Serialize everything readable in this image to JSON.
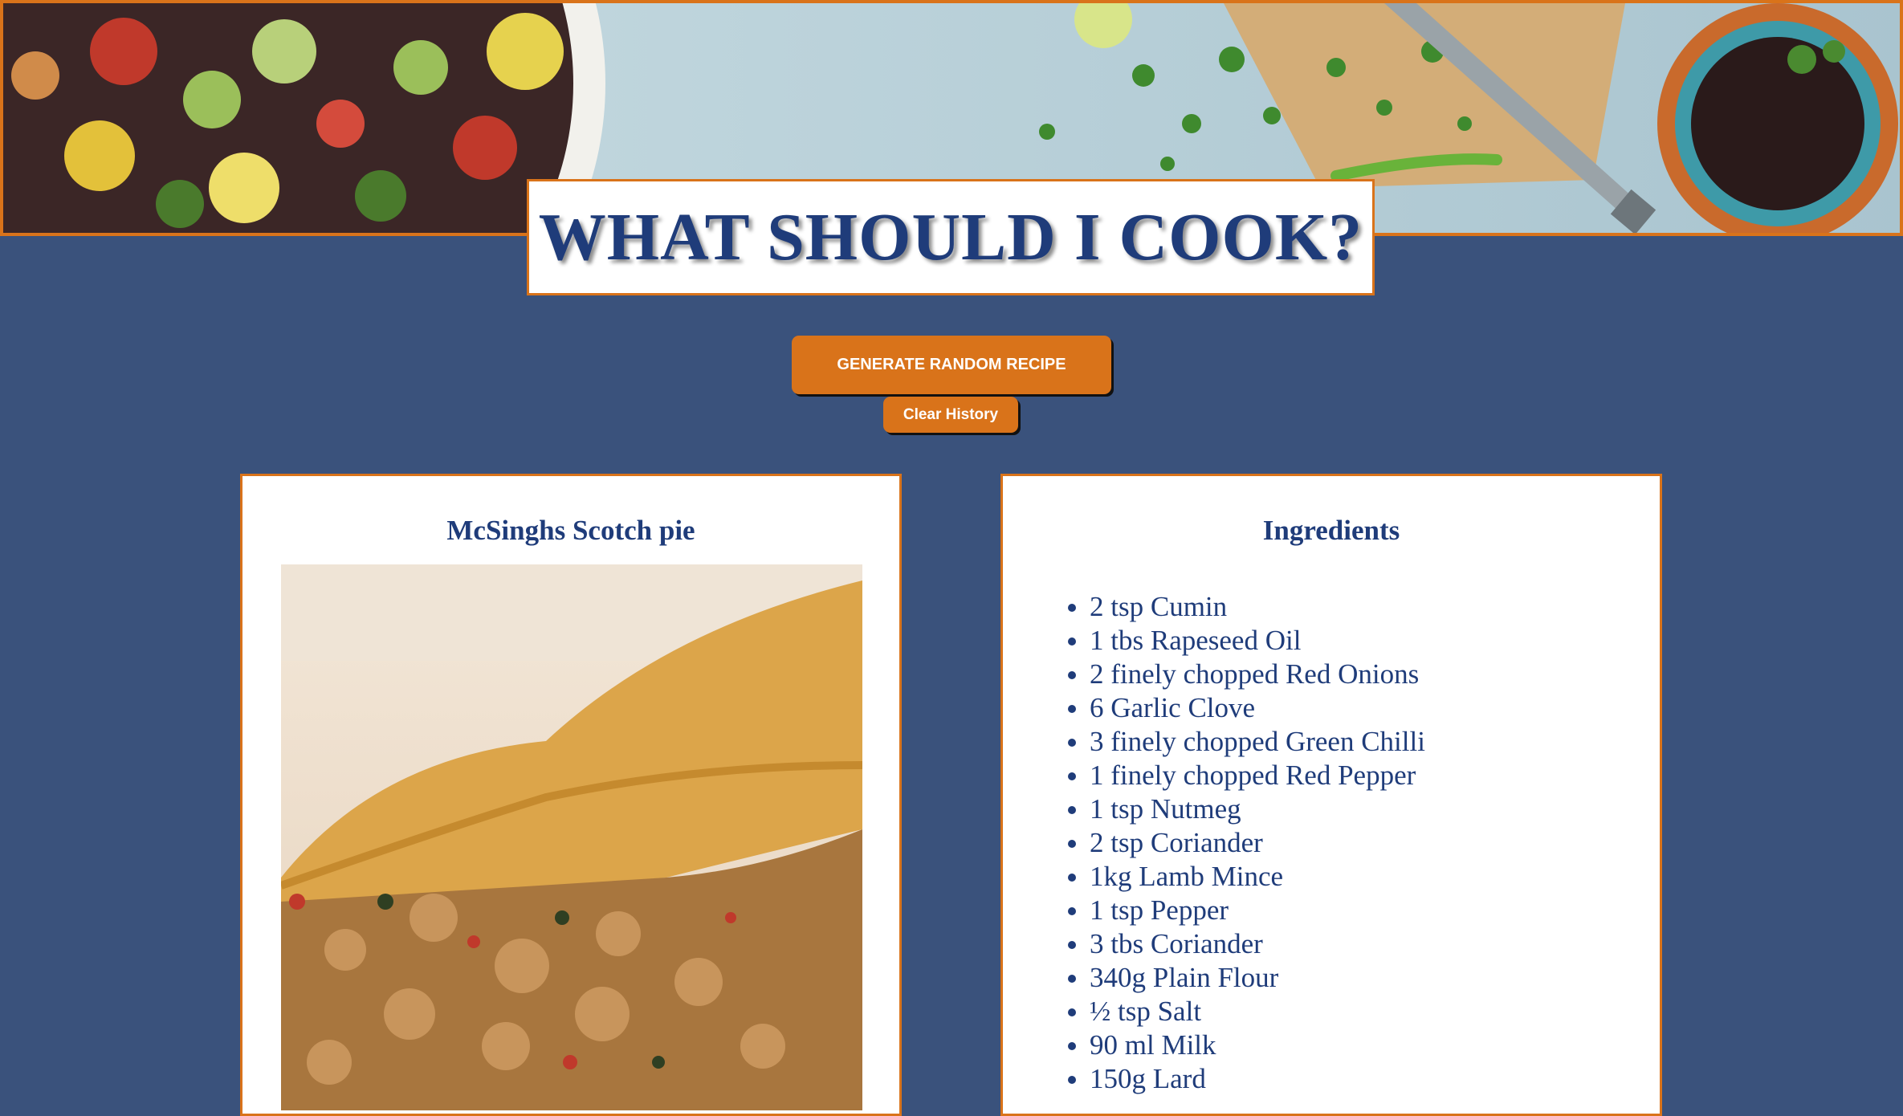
{
  "header": {
    "title": "WHAT SHOULD I COOK?",
    "hero_image": "food-ingredients-banner"
  },
  "actions": {
    "generate_label": "GENERATE RANDOM RECIPE",
    "clear_label": "Clear History"
  },
  "recipe": {
    "name": "McSinghs Scotch pie",
    "image": "scotch-pie-photo"
  },
  "ingredients": {
    "heading": "Ingredients",
    "items": [
      "2 tsp Cumin",
      "1 tbs Rapeseed Oil",
      "2 finely chopped Red Onions",
      "6 Garlic Clove",
      "3 finely chopped Green Chilli",
      "1 finely chopped Red Pepper",
      "1 tsp Nutmeg",
      "2 tsp Coriander",
      "1kg Lamb Mince",
      "1 tsp Pepper",
      "3 tbs Coriander",
      "340g Plain Flour",
      "½ tsp Salt",
      "90 ml Milk",
      "150g Lard"
    ]
  },
  "colors": {
    "background": "#3a527c",
    "accent": "#d9731a",
    "heading": "#1f3c7a",
    "card": "#ffffff"
  }
}
